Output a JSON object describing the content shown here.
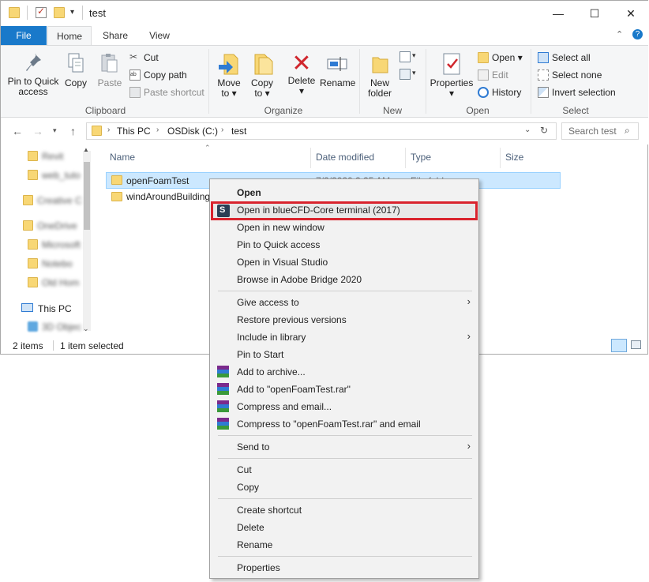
{
  "window": {
    "title": "test",
    "controls": [
      "—",
      "☐",
      "✕"
    ]
  },
  "ribbon_tabs": {
    "file": "File",
    "home": "Home",
    "share": "Share",
    "view": "View"
  },
  "ribbon": {
    "clipboard": {
      "pin_line1": "Pin to Quick",
      "pin_line2": "access",
      "copy": "Copy",
      "paste": "Paste",
      "cut": "Cut",
      "copy_path": "Copy path",
      "paste_shortcut": "Paste shortcut",
      "group": "Clipboard"
    },
    "organize": {
      "move_to_line1": "Move",
      "move_to_line2": "to ▾",
      "copy_to_line1": "Copy",
      "copy_to_line2": "to ▾",
      "delete_line1": "Delete",
      "delete_line2": "▾",
      "rename": "Rename",
      "group": "Organize"
    },
    "new": {
      "new_folder_line1": "New",
      "new_folder_line2": "folder",
      "group": "New"
    },
    "open": {
      "properties_line1": "Properties",
      "properties_line2": "▾",
      "open": "Open ▾",
      "edit": "Edit",
      "history": "History",
      "group": "Open"
    },
    "select": {
      "select_all": "Select all",
      "select_none": "Select none",
      "invert_selection": "Invert selection",
      "group": "Select"
    }
  },
  "address": {
    "crumbs": [
      "This PC",
      "OSDisk (C:)",
      "test"
    ],
    "search_placeholder": "Search test"
  },
  "nav_pane": {
    "blurred_items": [
      "Revit",
      "web_tuto",
      "Creative C",
      "OneDrive",
      "Microsoft",
      "Notebo",
      "Old Hom",
      "3D Objec"
    ],
    "this_pc": "This PC"
  },
  "columns": {
    "name": "Name",
    "date": "Date modified",
    "type": "Type",
    "size": "Size"
  },
  "files": [
    {
      "name": "openFoamTest",
      "date": "7/2/2020 2:25 AM",
      "type": "File folder"
    },
    {
      "name": "windAroundBuilding",
      "date": "",
      "type": ""
    }
  ],
  "status": {
    "items": "2 items",
    "selected": "1 item selected"
  },
  "context_menu": {
    "open": "Open",
    "bluecfd": "Open in blueCFD-Core terminal (2017)",
    "open_new_window": "Open in new window",
    "pin_quick": "Pin to Quick access",
    "open_vs": "Open in Visual Studio",
    "browse_bridge": "Browse in Adobe Bridge 2020",
    "give_access": "Give access to",
    "restore_prev": "Restore previous versions",
    "include_library": "Include in library",
    "pin_start": "Pin to Start",
    "add_archive": "Add to archive...",
    "add_rar": "Add to \"openFoamTest.rar\"",
    "compress_email": "Compress and email...",
    "compress_rar_email": "Compress to \"openFoamTest.rar\" and email",
    "send_to": "Send to",
    "cut": "Cut",
    "copy": "Copy",
    "create_shortcut": "Create shortcut",
    "delete": "Delete",
    "rename": "Rename",
    "properties": "Properties"
  },
  "colors": {
    "accent": "#1979ca",
    "selection": "#cce8ff",
    "highlight_box": "#d9232d",
    "folder": "#f8d775"
  }
}
